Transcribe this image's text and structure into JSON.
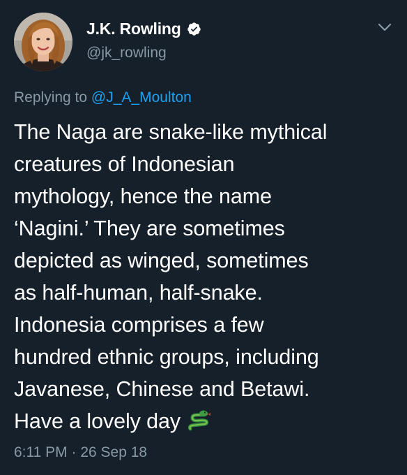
{
  "author": {
    "display_name": "J.K. Rowling",
    "handle": "@jk_rowling",
    "verified": true
  },
  "reply": {
    "prefix": "Replying to ",
    "mention": "@J_A_Moulton"
  },
  "tweet": {
    "lines": [
      "The Naga are snake-like mythical",
      "creatures of Indonesian",
      "mythology, hence the name",
      "‘Nagini.’ They are sometimes",
      "depicted as winged, sometimes",
      "as half-human, half-snake.",
      "Indonesia comprises a few",
      "hundred ethnic groups, including",
      "Javanese, Chinese and Betawi.",
      "Have a lovely day"
    ],
    "emoji": "snake-emoji"
  },
  "meta": {
    "time": "6:11 PM",
    "separator": " · ",
    "date": "26 Sep 18"
  },
  "colors": {
    "background": "#15202b",
    "text_primary": "#ffffff",
    "text_secondary": "#8899a6",
    "link": "#1da1f2",
    "verified_badge": "#ffffff"
  }
}
